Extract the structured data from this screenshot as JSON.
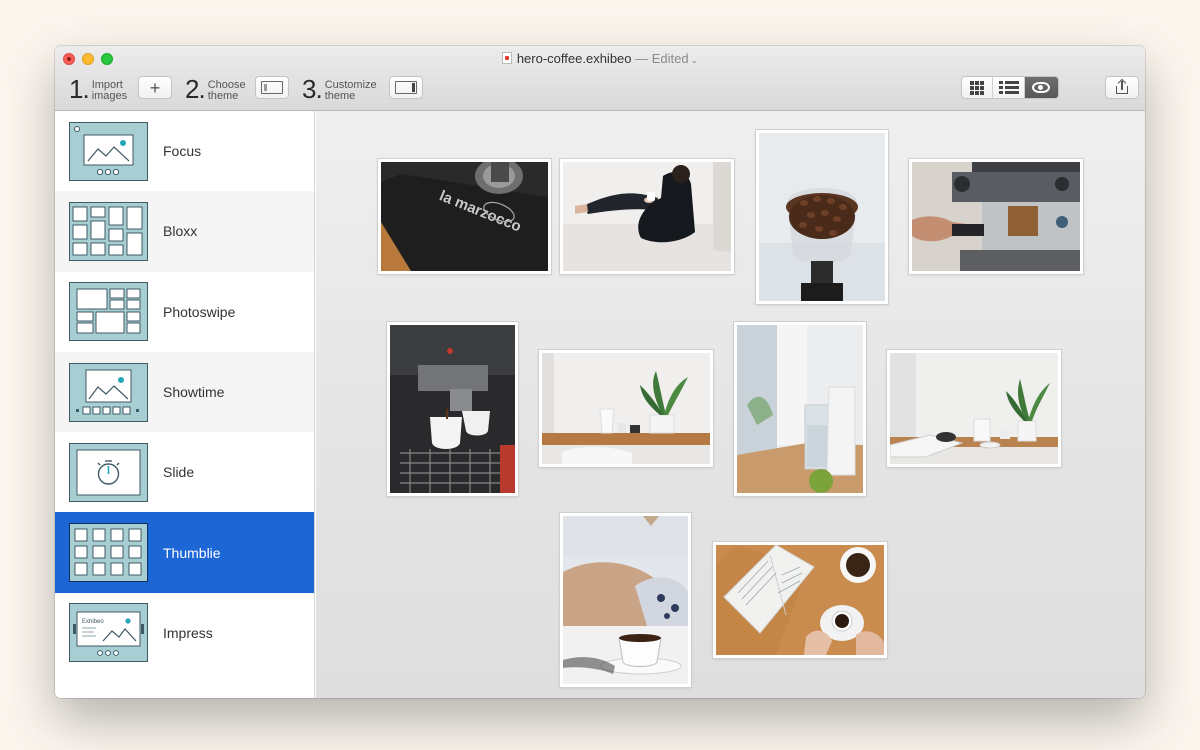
{
  "window": {
    "file_name": "hero-coffee.exhibeo",
    "status": "— Edited"
  },
  "toolbar": {
    "steps": [
      {
        "number": "1.",
        "label_line1": "Import",
        "label_line2": "images",
        "button_icon": "plus-icon"
      },
      {
        "number": "2.",
        "label_line1": "Choose",
        "label_line2": "theme",
        "button_icon": "theme-left-icon"
      },
      {
        "number": "3.",
        "label_line1": "Customize",
        "label_line2": "theme",
        "button_icon": "theme-right-icon"
      }
    ],
    "view_modes": [
      {
        "icon": "grid-view-icon",
        "active": false
      },
      {
        "icon": "list-view-icon",
        "active": false
      },
      {
        "icon": "preview-eye-icon",
        "active": true
      }
    ],
    "share_icon": "share-icon"
  },
  "sidebar": {
    "themes": [
      {
        "label": "Focus",
        "icon": "focus-theme-thumbnail",
        "selected": false
      },
      {
        "label": "Bloxx",
        "icon": "bloxx-theme-thumbnail",
        "selected": false
      },
      {
        "label": "Photoswipe",
        "icon": "photoswipe-theme-thumbnail",
        "selected": false
      },
      {
        "label": "Showtime",
        "icon": "showtime-theme-thumbnail",
        "selected": false
      },
      {
        "label": "Slide",
        "icon": "slide-theme-thumbnail",
        "selected": false
      },
      {
        "label": "Thumblie",
        "icon": "thumblie-theme-thumbnail",
        "selected": true
      },
      {
        "label": "Impress",
        "icon": "impress-theme-thumbnail",
        "selected": false
      }
    ],
    "impress_thumb_text": "Exhibeo"
  },
  "gallery": {
    "photos": [
      {
        "subject": "la marzocco portafilter towel",
        "text": "la marzocco"
      },
      {
        "subject": "woman sitting on bed with coffee"
      },
      {
        "subject": "coffee beans in grinder hopper"
      },
      {
        "subject": "barista with espresso machine"
      },
      {
        "subject": "espresso pouring into cups"
      },
      {
        "subject": "pitcher and plant on wooden table"
      },
      {
        "subject": "glass of water and lime"
      },
      {
        "subject": "breakfast table with plant"
      },
      {
        "subject": "cup of coffee on saucer"
      },
      {
        "subject": "hands with coffee and open book"
      }
    ]
  },
  "colors": {
    "selection_blue": "#1d66d6",
    "thumb_fill": "#a7cfd3",
    "thumb_accent": "#25a6b8"
  }
}
